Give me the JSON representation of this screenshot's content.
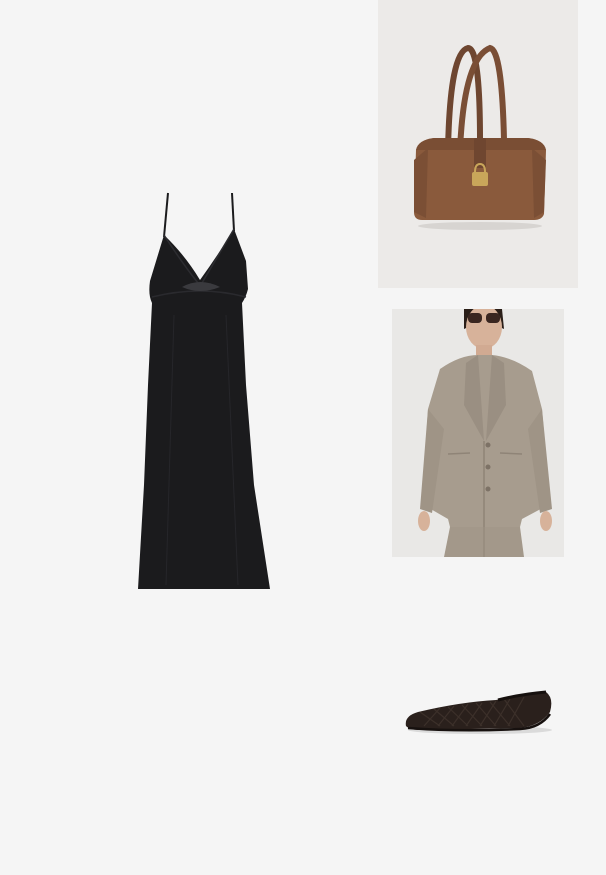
{
  "board": {
    "background_color": "#f5f5f5"
  },
  "items": {
    "dress": {
      "icon": "black-slip-dress",
      "color": "#1b1b1d"
    },
    "bag": {
      "icon": "brown-leather-tote-bag",
      "color": "#8a5a3c",
      "hardware_color": "#c9a65a"
    },
    "blazer": {
      "icon": "taupe-blazer-model",
      "color": "#a79c8e"
    },
    "flat": {
      "icon": "woven-ballet-flat",
      "color": "#2a201c"
    }
  }
}
